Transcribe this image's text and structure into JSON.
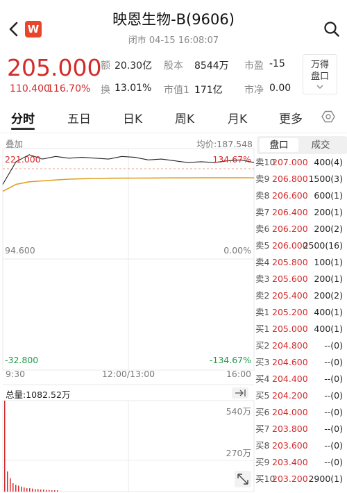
{
  "header": {
    "title": "映恩生物-B(9606)",
    "subtitle": "闭市  04-15 16:08:07",
    "logo_letter": "W"
  },
  "quote": {
    "price": "205.000",
    "change": "110.400",
    "change_pct": "116.70%",
    "stats": [
      {
        "label": "额",
        "value": "20.30亿"
      },
      {
        "label": "股本",
        "value": "8544万"
      },
      {
        "label": "市盈",
        "value": "-15"
      },
      {
        "label": "换",
        "value": "13.01%"
      },
      {
        "label": "市值1",
        "value": "171亿"
      },
      {
        "label": "市净",
        "value": "0.00"
      }
    ],
    "trade_button": "万得盘口"
  },
  "tabs": [
    "分时",
    "五日",
    "日K",
    "周K",
    "月K",
    "更多"
  ],
  "chart": {
    "overlay_label": "叠加",
    "avg_label": "均价:187.548",
    "y_top_left": "221.000",
    "y_top_right": "134.67%",
    "y_mid_left": "94.600",
    "y_mid_right": "0.00%",
    "y_bot_left": "-32.800",
    "y_bot_right": "-134.67%",
    "x_labels": [
      "9:30",
      "12:00/13:00",
      "16:00"
    ],
    "volume_label": "总量:1082.52万",
    "vol_ticks": [
      "540万",
      "270万"
    ]
  },
  "chart_data": {
    "type": "line",
    "title": "",
    "xlabel": "",
    "ylabel": "",
    "x": [
      "9:30",
      "12:00/13:00",
      "16:00"
    ],
    "ylim": [
      -32.8,
      221.0
    ],
    "series": [
      {
        "values": [
          180,
          206,
          214,
          209,
          212,
          210,
          211,
          210,
          209,
          212,
          211,
          208,
          209,
          207,
          205,
          206,
          205,
          207,
          208,
          205
        ]
      },
      {
        "values": [
          172,
          180,
          183,
          184,
          185,
          186,
          186.5,
          186.8,
          187,
          187.1,
          187.2,
          187.3,
          187.35,
          187.4,
          187.45,
          187.5,
          187.52,
          187.53,
          187.54,
          187.548
        ]
      }
    ],
    "volume": {
      "ylim": [
        0,
        540
      ],
      "unit": "万",
      "values": [
        540,
        120,
        80,
        50,
        40,
        35,
        30,
        25,
        20,
        20,
        18,
        15,
        15,
        12,
        12,
        10,
        10,
        8,
        8,
        8
      ]
    }
  },
  "orderbook": {
    "tabs": [
      "盘口",
      "成交"
    ],
    "rows": [
      {
        "label": "卖10",
        "price": "207.000",
        "vol": "400(4)"
      },
      {
        "label": "卖9",
        "price": "206.800",
        "vol": "1500(3)"
      },
      {
        "label": "卖8",
        "price": "206.600",
        "vol": "600(1)"
      },
      {
        "label": "卖7",
        "price": "206.400",
        "vol": "200(1)"
      },
      {
        "label": "卖6",
        "price": "206.200",
        "vol": "200(2)"
      },
      {
        "label": "卖5",
        "price": "206.000",
        "vol": "2500(16)"
      },
      {
        "label": "卖4",
        "price": "205.800",
        "vol": "100(1)"
      },
      {
        "label": "卖3",
        "price": "205.600",
        "vol": "200(1)"
      },
      {
        "label": "卖2",
        "price": "205.400",
        "vol": "200(2)"
      },
      {
        "label": "卖1",
        "price": "205.200",
        "vol": "400(1)"
      },
      {
        "label": "买1",
        "price": "205.000",
        "vol": "400(1)"
      },
      {
        "label": "买2",
        "price": "204.800",
        "vol": "--(0)"
      },
      {
        "label": "买3",
        "price": "204.600",
        "vol": "--(0)"
      },
      {
        "label": "买4",
        "price": "204.400",
        "vol": "--(0)"
      },
      {
        "label": "买5",
        "price": "204.200",
        "vol": "--(0)"
      },
      {
        "label": "买6",
        "price": "204.000",
        "vol": "--(0)"
      },
      {
        "label": "买7",
        "price": "203.800",
        "vol": "--(0)"
      },
      {
        "label": "买8",
        "price": "203.600",
        "vol": "--(0)"
      },
      {
        "label": "买9",
        "price": "203.400",
        "vol": "--(0)"
      },
      {
        "label": "买10",
        "price": "203.200",
        "vol": "2900(1)"
      }
    ]
  },
  "colors": {
    "up": "#d42a2a",
    "down": "#1e9a4a",
    "avg_line": "#e0a020",
    "price_line": "#222222"
  }
}
